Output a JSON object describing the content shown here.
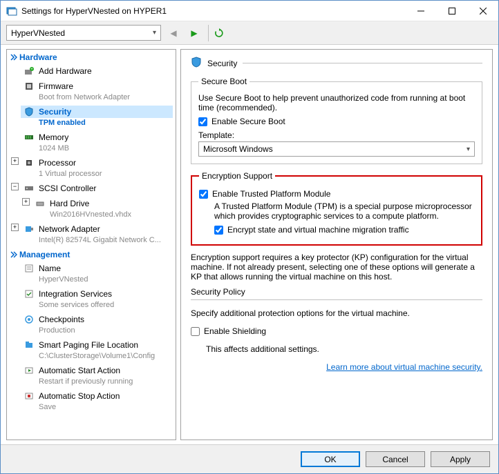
{
  "window": {
    "title": "Settings for HyperVNested on HYPER1"
  },
  "toolbar": {
    "selected_vm": "HyperVNested"
  },
  "sidebar": {
    "hardware_label": "Hardware",
    "management_label": "Management",
    "items": {
      "add_hardware": {
        "label": "Add Hardware"
      },
      "firmware": {
        "label": "Firmware",
        "sub": "Boot from Network Adapter"
      },
      "security": {
        "label": "Security",
        "sub": "TPM enabled"
      },
      "memory": {
        "label": "Memory",
        "sub": "1024 MB"
      },
      "processor": {
        "label": "Processor",
        "sub": "1 Virtual processor"
      },
      "scsi": {
        "label": "SCSI Controller"
      },
      "hard_drive": {
        "label": "Hard Drive",
        "sub": "Win2016HVnested.vhdx"
      },
      "net_adapter": {
        "label": "Network Adapter",
        "sub": "Intel(R) 82574L Gigabit Network C..."
      },
      "name": {
        "label": "Name",
        "sub": "HyperVNested"
      },
      "integration": {
        "label": "Integration Services",
        "sub": "Some services offered"
      },
      "checkpoints": {
        "label": "Checkpoints",
        "sub": "Production"
      },
      "paging": {
        "label": "Smart Paging File Location",
        "sub": "C:\\ClusterStorage\\Volume1\\Config"
      },
      "auto_start": {
        "label": "Automatic Start Action",
        "sub": "Restart if previously running"
      },
      "auto_stop": {
        "label": "Automatic Stop Action",
        "sub": "Save"
      }
    }
  },
  "panel": {
    "title": "Security",
    "secure_boot": {
      "legend": "Secure Boot",
      "desc": "Use Secure Boot to help prevent unauthorized code from running at boot time (recommended).",
      "enable_label": "Enable Secure Boot",
      "template_label": "Template:",
      "template_value": "Microsoft Windows"
    },
    "encryption": {
      "legend": "Encryption Support",
      "enable_tpm_label": "Enable Trusted Platform Module",
      "tpm_desc": "A Trusted Platform Module (TPM) is a special purpose microprocessor which provides cryptographic services to a compute platform.",
      "encrypt_traffic_label": "Encrypt state and virtual machine migration traffic"
    },
    "kp_note": "Encryption support requires a key protector (KP) configuration for the virtual machine. If not already present, selecting one of these options will generate a KP that allows running the virtual machine on this host.",
    "policy": {
      "heading": "Security Policy",
      "desc": "Specify additional protection options for the virtual machine.",
      "shielding_label": "Enable Shielding",
      "shielding_note": "This affects additional settings."
    },
    "learn_more": "Learn more about virtual machine security."
  },
  "footer": {
    "ok": "OK",
    "cancel": "Cancel",
    "apply": "Apply"
  }
}
